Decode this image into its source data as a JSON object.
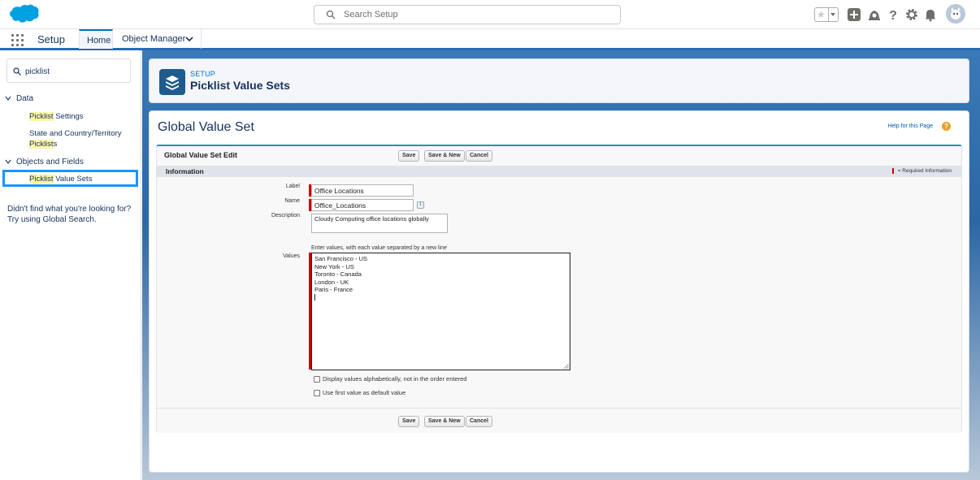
{
  "global_header": {
    "search_placeholder": "Search Setup",
    "icons": [
      "salesforce-cloud-logo",
      "favorites-star-icon",
      "favorites-dropdown-icon",
      "global-actions-plus-icon",
      "trailhead-icon",
      "help-icon",
      "setup-gear-icon",
      "notifications-bell-icon",
      "user-avatar"
    ]
  },
  "context_nav": {
    "app_name": "Setup",
    "tabs": [
      {
        "label": "Home",
        "active": true
      },
      {
        "label": "Object Manager",
        "active": false
      }
    ]
  },
  "sidebar": {
    "search_value": "picklist",
    "groups": [
      {
        "label": "Data",
        "items": [
          {
            "highlight": "Picklist",
            "rest": " Settings"
          },
          {
            "line1": "State and Country/Territory",
            "highlight": "Picklist",
            "rest": "s"
          }
        ]
      },
      {
        "label": "Objects and Fields",
        "items": [
          {
            "highlight": "Picklist",
            "rest": " Value Sets",
            "selected": true
          }
        ]
      }
    ],
    "help_text_1": "Didn't find what you're looking for?",
    "help_text_2": "Try using Global Search."
  },
  "page_header": {
    "eyebrow": "SETUP",
    "title": "Picklist Value Sets"
  },
  "content": {
    "title": "Global Value Set",
    "help_link": "Help for this Page",
    "form_title": "Global Value Set Edit",
    "buttons": {
      "save": "Save",
      "save_new": "Save & New",
      "cancel": "Cancel"
    },
    "section_title": "Information",
    "required_legend": "= Required Information",
    "fields": {
      "label_label": "Label",
      "label_value": "Office Locations",
      "name_label": "Name",
      "name_value": "Office_Locations",
      "info_icon": "i",
      "description_label": "Description",
      "description_value": "Cloudy Computing office locations globally",
      "values_hint": "Enter values, with each value separated by a new line",
      "values_label": "Values",
      "values": [
        "San Francisco - US",
        "New York - US",
        "Toronto - Canada",
        "London - UK",
        "Paris - France"
      ],
      "checkbox_alpha": "Display values alphabetically, not in the order entered",
      "checkbox_default": "Use first value as default value"
    }
  },
  "colors": {
    "brand_blue": "#0070d2",
    "required_red": "#cc0000",
    "selected_outline": "#1b96ff",
    "highlight": "#fff6a8"
  }
}
